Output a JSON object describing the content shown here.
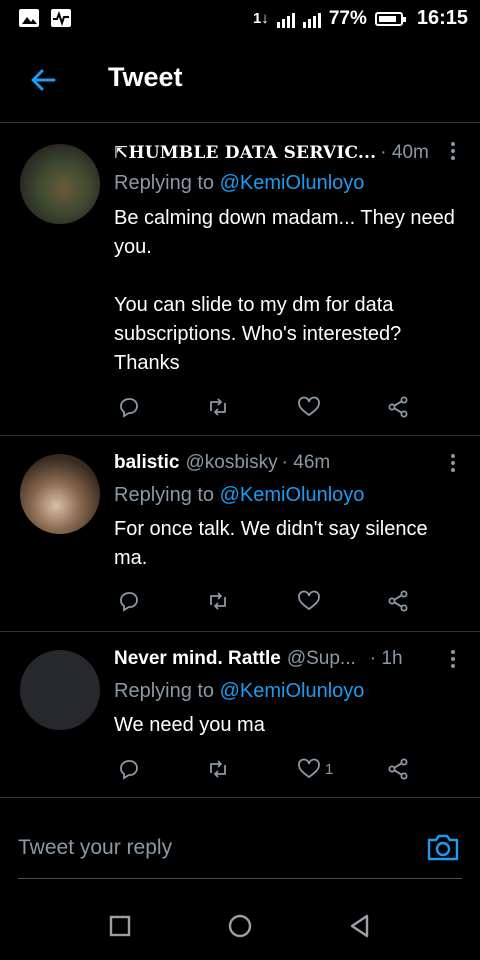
{
  "status_bar": {
    "network": "1↓",
    "battery_percent": "77%",
    "time": "16:15"
  },
  "header": {
    "title": "Tweet"
  },
  "tweets": [
    {
      "name": "⇱HUMBLE DATA SERVIC...",
      "handle": "",
      "time": "· 40m",
      "reply_prefix": "Replying to ",
      "reply_to": "@KemiOlunloyo",
      "text": "Be calming down madam... They need you.\n\nYou can slide to my dm for data subscriptions. Who's interested? Thanks",
      "likes": ""
    },
    {
      "name": "balistic",
      "handle": "@kosbisky",
      "time": "· 46m",
      "reply_prefix": "Replying to ",
      "reply_to": "@KemiOlunloyo",
      "text": "For once talk. We didn't say silence ma.",
      "likes": ""
    },
    {
      "name": "Never mind. Rattle",
      "handle": "@Sup...",
      "time": "· 1h",
      "reply_prefix": "Replying to ",
      "reply_to": "@KemiOlunloyo",
      "text": "We need you ma",
      "likes": "1"
    }
  ],
  "reply_bar": {
    "placeholder": "Tweet your reply"
  },
  "colors": {
    "accent": "#1d9bf0",
    "muted": "#8b98a5",
    "background": "#000000"
  }
}
